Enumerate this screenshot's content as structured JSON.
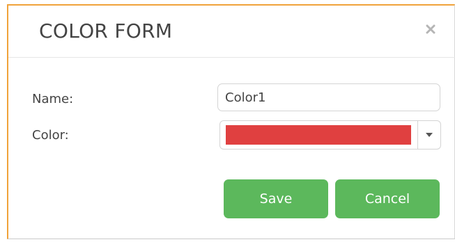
{
  "dialog": {
    "title": "COLOR FORM",
    "close_icon": "close-icon"
  },
  "form": {
    "name_label": "Name:",
    "name_value": "Color1",
    "color_label": "Color:",
    "color_value": "#e04040",
    "dropdown_icon": "chevron-down-icon"
  },
  "actions": {
    "save_label": "Save",
    "cancel_label": "Cancel"
  },
  "colors": {
    "accent_border": "#f0a23a",
    "button_green": "#5cb85c",
    "text": "#444444"
  }
}
